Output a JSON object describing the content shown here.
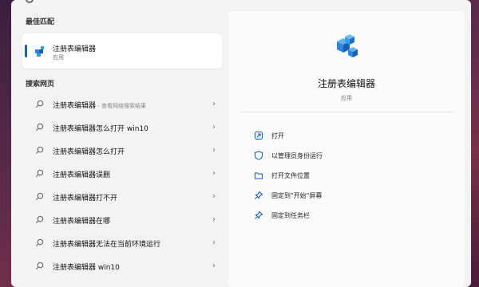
{
  "left": {
    "best_match_title": "最佳匹配",
    "best_match": {
      "name": "注册表编辑器",
      "type": "应用"
    },
    "web_search_title": "搜索网页",
    "web_results": [
      {
        "text": "注册表编辑器",
        "suffix": " - 查看网络搜索结果"
      },
      {
        "text": "注册表编辑器怎么打开 win10",
        "suffix": ""
      },
      {
        "text": "注册表编辑器怎么打开",
        "suffix": ""
      },
      {
        "text": "注册表编辑器误删",
        "suffix": ""
      },
      {
        "text": "注册表编辑器打不开",
        "suffix": ""
      },
      {
        "text": "注册表编辑器在哪",
        "suffix": ""
      },
      {
        "text": "注册表编辑器无法在当前环境运行",
        "suffix": ""
      },
      {
        "text": "注册表编辑器 win10",
        "suffix": ""
      }
    ],
    "chevron": "›"
  },
  "right": {
    "title": "注册表编辑器",
    "subtitle": "应用",
    "actions": [
      {
        "label": "打开",
        "icon": "open-icon"
      },
      {
        "label": "以管理员身份运行",
        "icon": "shield-icon"
      },
      {
        "label": "打开文件位置",
        "icon": "folder-icon"
      },
      {
        "label": "固定到\"开始\"屏幕",
        "icon": "pin-icon"
      },
      {
        "label": "固定到任务栏",
        "icon": "pin-icon"
      }
    ]
  },
  "colors": {
    "accent": "#1a5fb4",
    "icon_blue": "#2b88d8"
  }
}
